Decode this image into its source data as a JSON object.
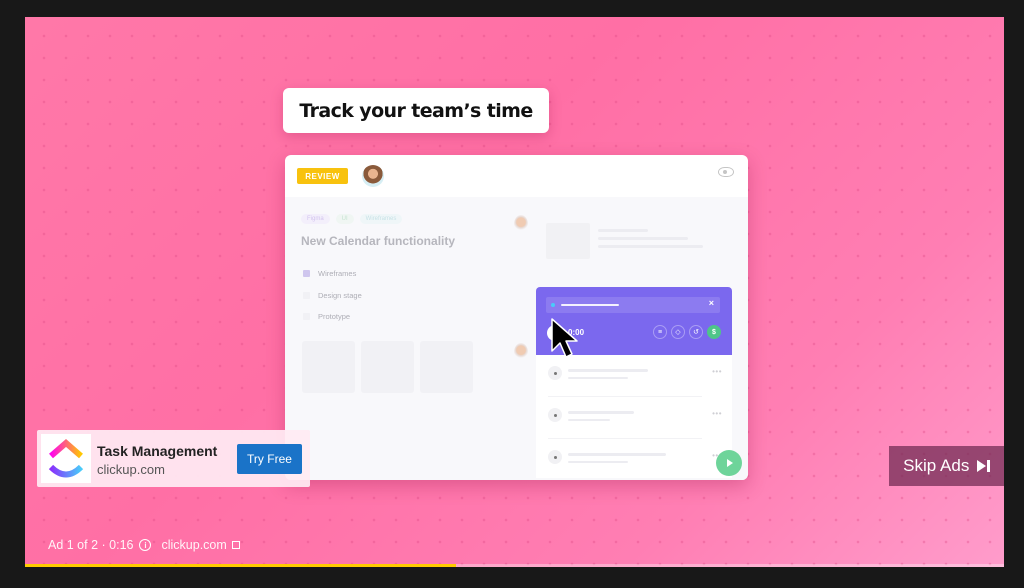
{
  "video": {
    "headline": "Track your team’s time",
    "app_mock": {
      "status_badge": "REVIEW",
      "tags": [
        "Figma",
        "UI",
        "Wireframes"
      ],
      "task_title": "New Calendar functionality",
      "checklist": [
        {
          "label": "Wireframes",
          "checked": true
        },
        {
          "label": "Design stage",
          "checked": false
        },
        {
          "label": "Prototype",
          "checked": false
        }
      ],
      "timer": {
        "time": "0:00",
        "close_glyph": "×",
        "icons": [
          "notes-icon",
          "tag-icon",
          "history-icon",
          "billable-dollar-icon"
        ],
        "billable_glyph": "$"
      },
      "more_glyph": "•••"
    },
    "accent_color": "#7b68ee"
  },
  "companion_ad": {
    "title": "Task Management",
    "domain": "clickup.com",
    "cta_label": "Try Free"
  },
  "skip": {
    "label": "Skip Ads"
  },
  "ad_info": {
    "position": "Ad 1 of 2 · 0:16",
    "advertiser": "clickup.com"
  },
  "progress": {
    "played_fraction": 0.44,
    "color": "#ffcc00"
  }
}
